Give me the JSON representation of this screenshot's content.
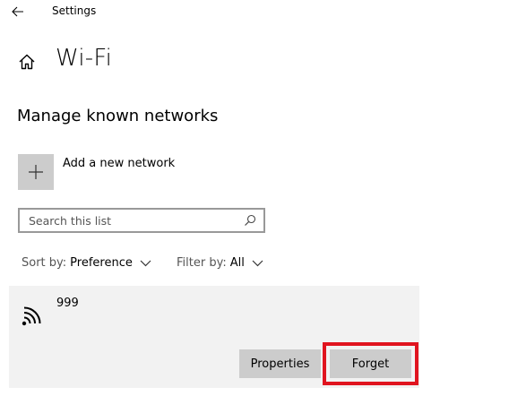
{
  "titlebar": {
    "back_icon": "arrow-left-icon",
    "app_title": "Settings"
  },
  "header": {
    "home_icon": "home-icon",
    "title": "Wi-Fi"
  },
  "section": {
    "title": "Manage known networks"
  },
  "add_network": {
    "icon": "plus-icon",
    "label": "Add a new network"
  },
  "search": {
    "placeholder": "Search this list",
    "value": "",
    "icon": "search-icon"
  },
  "sort": {
    "label": "Sort by:",
    "value": "Preference"
  },
  "filter": {
    "label": "Filter by:",
    "value": "All"
  },
  "networks": [
    {
      "name": "999",
      "icon": "wifi-signal-icon",
      "actions": {
        "properties_label": "Properties",
        "forget_label": "Forget"
      }
    }
  ],
  "colors": {
    "tile_bg": "#cccccc",
    "card_bg": "#f2f2f2",
    "highlight": "#e0141f",
    "search_border": "#999999"
  }
}
